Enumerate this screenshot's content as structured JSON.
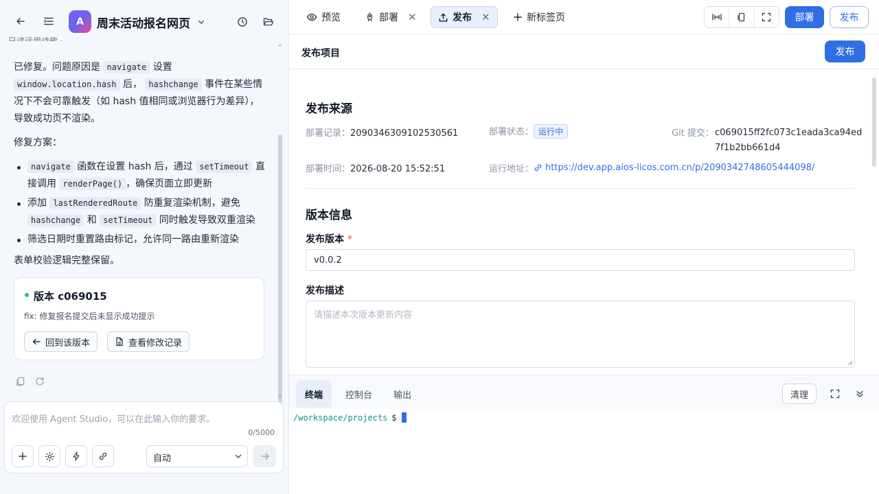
{
  "app": {
    "title": "周末活动报名网页",
    "logo_letter": "A"
  },
  "chat": {
    "cut_text": "已读运用诗歌 ·",
    "para1_a": "已修复。问题原因是",
    "para1_code1": "navigate",
    "para1_b": "设置",
    "para1_code2": "window.location.hash",
    "para1_c": "后，",
    "para1_code3": "hashchange",
    "para1_d": "事件在某些情况下不会可靠触发（如 hash 值相同或浏览器行为差异），导致成功页不渲染。",
    "plan_title": "修复方案：",
    "items": [
      {
        "code1": "navigate",
        "t1": "函数在设置 hash 后，通过",
        "code2": "setTimeout",
        "t2": "直接调用",
        "code3": "renderPage()",
        "t3": "，确保页面立即更新"
      },
      {
        "t0": "添加",
        "code1": "lastRenderedRoute",
        "t1": "防重复渲染机制，避免",
        "code2": "hashchange",
        "t2": "和",
        "code3": "setTimeout",
        "t3": "同时触发导致双重渲染"
      },
      {
        "t0": "筛选日期时重置路由标记，允许同一路由重新渲染"
      }
    ],
    "closing": "表单校验逻辑完整保留。"
  },
  "version_card": {
    "title": "版本 c069015",
    "desc": "fix: 修复报名提交后未显示成功提示",
    "btn_back": "回到该版本",
    "btn_log": "查看修改记录"
  },
  "input": {
    "placeholder": "欢迎使用 Agent Studio，可以在此输入你的要求。",
    "counter": "0/5000",
    "mode_value": "自动"
  },
  "tabs": [
    {
      "label": "预览"
    },
    {
      "label": "部署"
    },
    {
      "label": "发布"
    },
    {
      "label": "新标签页"
    }
  ],
  "toolbar": {
    "deploy_label": "部署",
    "publish_label": "发布"
  },
  "publish": {
    "panel_title": "发布项目",
    "publish_btn": "发布",
    "source_title": "发布来源",
    "deploy_record_label": "部署记录：",
    "deploy_record_value": "2090346309102530561",
    "deploy_status_label": "部署状态：",
    "deploy_status_value": "运行中",
    "git_label": "Git 提交：",
    "git_value_line1": "c069015ff2fc073c1eada3ca94ed",
    "git_value_line2": "7f1b2bb661d4",
    "deploy_time_label": "部署时间：",
    "deploy_time_value": "2026-08-20 15:52:51",
    "run_url_label": "运行地址：",
    "run_url_value": "https://dev.app.aios-licos.com.cn/p/2090342748605444098/",
    "version_title": "版本信息",
    "version_label": "发布版本",
    "version_value": "v0.0.2",
    "desc_label": "发布描述",
    "desc_placeholder": "请描述本次版本更新内容"
  },
  "terminal": {
    "tabs": [
      "终端",
      "控制台",
      "输出"
    ],
    "clear_label": "清理",
    "path": "/workspace/projects",
    "prompt": "$"
  },
  "colors": {
    "accent": "#2f6fe4",
    "status_green": "#22c55e"
  }
}
